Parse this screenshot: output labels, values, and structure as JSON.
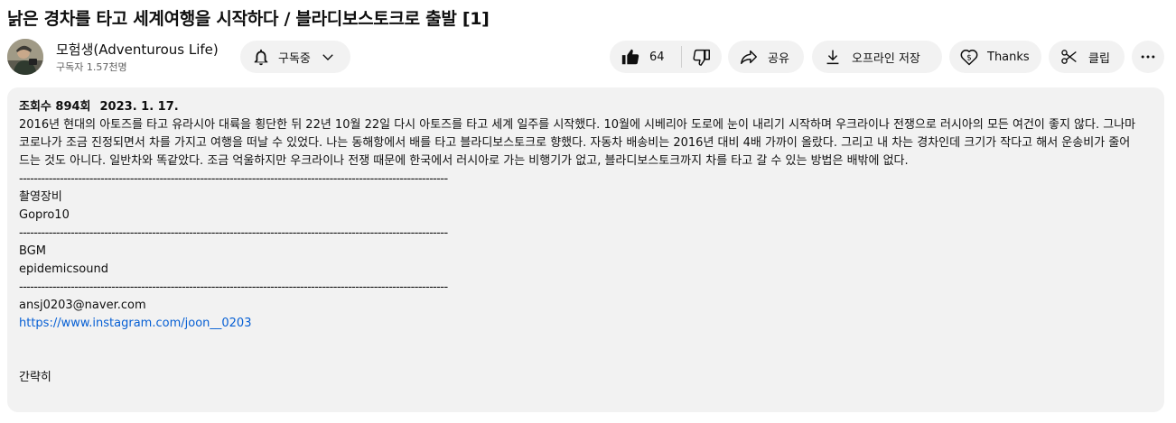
{
  "video": {
    "title": "낡은 경차를 타고 세계여행을 시작하다 / 블라디보스토크로 출발 [1]"
  },
  "channel": {
    "name": "모험생(Adventurous Life)",
    "subscribers": "구독자 1.57천명",
    "avatar_icon": "channel-avatar"
  },
  "actions": {
    "subscribe_label": "구독중",
    "like_count": "64",
    "share_label": "공유",
    "download_label": "오프라인 저장",
    "thanks_label": "Thanks",
    "clip_label": "클립",
    "icons": [
      "bell-icon",
      "chevron-down-icon",
      "thumbs-up-icon",
      "thumbs-down-icon",
      "share-icon",
      "download-icon",
      "thanks-icon",
      "scissors-icon",
      "more-icon"
    ]
  },
  "description": {
    "views": "조회수 894회",
    "date": "2023. 1. 17.",
    "text": "2016년 현대의 아토즈를 타고 유라시아 대륙을 횡단한 뒤 22년 10월 22일 다시 아토즈를 타고 세계 일주를 시작했다. 10월에 시베리아 도로에 눈이 내리기 시작하며 우크라이나 전쟁으로 러시아의 모든 여건이 좋지 않다. 그나마 코로나가 조금 진정되면서 차를 가지고 여행을 떠날 수 있었다. 나는 동해항에서 배를 타고 블라디보스토크로 향했다. 자동차 배송비는 2016년 대비 4배 가까이 올랐다. 그리고 내 차는 경차인데 크기가 작다고 해서 운송비가 줄어드는 것도 아니다. 일반차와 똑같았다. 조금 억울하지만 우크라이나 전쟁 때문에 한국에서 러시아로 가는 비행기가 없고, 블라디보스토크까지 차를 타고 갈 수 있는 방법은 배밖에 없다.",
    "separator": "-------------------------------------------------------------------------------------------------------------------------------------------------------------------------------------------------",
    "gear_heading": "촬영장비",
    "gear_value": "Gopro10",
    "bgm_heading": "BGM",
    "bgm_value": "epidemicsound",
    "email": "ansj0203@naver.com",
    "instagram": "https://www.instagram.com/joon__0203",
    "collapse_label": "간략히"
  }
}
